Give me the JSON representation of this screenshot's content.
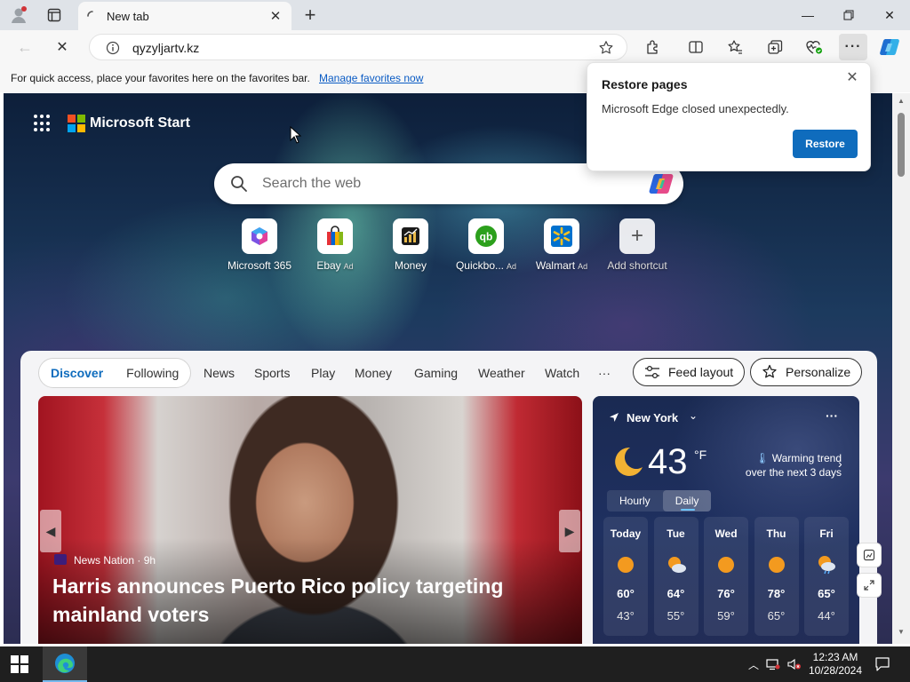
{
  "browser": {
    "tab_title": "New tab",
    "url": "qyzyljartv.kz",
    "favorites_hint": "For quick access, place your favorites here on the favorites bar.",
    "favorites_link": "Manage favorites now"
  },
  "restore_popup": {
    "title": "Restore pages",
    "message": "Microsoft Edge closed unexpectedly.",
    "button": "Restore"
  },
  "newtab": {
    "brand": "Microsoft Start",
    "search_placeholder": "Search the web",
    "shortcuts": [
      {
        "label": "Microsoft 365",
        "ad": ""
      },
      {
        "label": "Ebay",
        "ad": "Ad"
      },
      {
        "label": "Money",
        "ad": ""
      },
      {
        "label": "Quickbo...",
        "ad": "Ad"
      },
      {
        "label": "Walmart",
        "ad": "Ad"
      },
      {
        "label": "Add shortcut",
        "ad": ""
      }
    ]
  },
  "feed_nav": {
    "discover": "Discover",
    "following": "Following",
    "items": [
      "News",
      "Sports",
      "Play",
      "Money",
      "Gaming",
      "Weather",
      "Watch"
    ],
    "more": "···",
    "feed_layout": "Feed layout",
    "personalize": "Personalize"
  },
  "hero": {
    "source": "News Nation",
    "age": "9h",
    "headline": "Harris announces Puerto Rico policy targeting mainland voters"
  },
  "weather": {
    "location": "New York",
    "temp": "43",
    "unit": "°F",
    "trend_line1": "Warming trend",
    "trend_line2": "over the next 3 days",
    "tabs": [
      "Hourly",
      "Daily"
    ],
    "days": [
      {
        "day": "Today",
        "hi": "60°",
        "lo": "43°",
        "icon": "sunny"
      },
      {
        "day": "Tue",
        "hi": "64°",
        "lo": "55°",
        "icon": "partly-cloudy"
      },
      {
        "day": "Wed",
        "hi": "76°",
        "lo": "59°",
        "icon": "sunny"
      },
      {
        "day": "Thu",
        "hi": "78°",
        "lo": "65°",
        "icon": "sunny"
      },
      {
        "day": "Fri",
        "hi": "65°",
        "lo": "44°",
        "icon": "partly-cloudy-rain"
      }
    ]
  },
  "taskbar": {
    "time": "12:23 AM",
    "date": "10/28/2024"
  },
  "colors": {
    "accent": "#0f6cbd",
    "link": "#0a5bc4",
    "sun": "#f39a1f"
  }
}
